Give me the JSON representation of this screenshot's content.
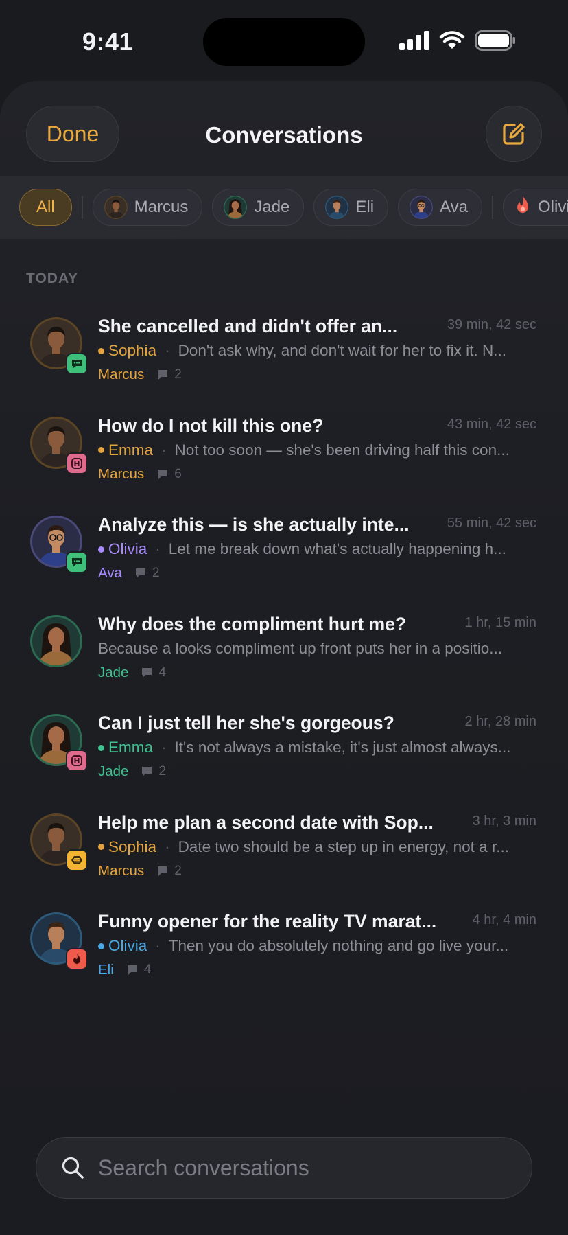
{
  "status": {
    "time": "9:41"
  },
  "nav": {
    "done_label": "Done",
    "title": "Conversations"
  },
  "filters": [
    {
      "label": "All",
      "kind": "all"
    },
    {
      "label": "Marcus",
      "kind": "person",
      "avatar": "marcus"
    },
    {
      "label": "Jade",
      "kind": "person",
      "avatar": "jade"
    },
    {
      "label": "Eli",
      "kind": "person",
      "avatar": "eli"
    },
    {
      "label": "Ava",
      "kind": "person",
      "avatar": "ava"
    },
    {
      "label": "Olivia",
      "kind": "flame"
    }
  ],
  "section_label": "TODAY",
  "conversations": [
    {
      "title": "She cancelled and didn't offer an...",
      "time": "39 min, 42 sec",
      "recipient": "Sophia",
      "preview": "Don't ask why, and don't wait for her to fix it. N...",
      "coach": "Marcus",
      "count": "2",
      "avatar": "marcus",
      "badge": "chat"
    },
    {
      "title": "How do I not kill this one?",
      "time": "43 min, 42 sec",
      "recipient": "Emma",
      "preview": "Not too soon — she's been driving half this con...",
      "coach": "Marcus",
      "count": "6",
      "avatar": "marcus",
      "badge": "hinge"
    },
    {
      "title": "Analyze this — is she actually inte...",
      "time": "55 min, 42 sec",
      "recipient": "Olivia",
      "preview": "Let me break down what's actually happening h...",
      "coach": "Ava",
      "count": "2",
      "avatar": "ava",
      "badge": "chat"
    },
    {
      "title": "Why does the compliment hurt me?",
      "time": "1 hr, 15 min",
      "recipient": "",
      "preview": "Because a looks compliment up front puts her in a positio...",
      "coach": "Jade",
      "count": "4",
      "avatar": "jade",
      "badge": ""
    },
    {
      "title": "Can I just tell her she's gorgeous?",
      "time": "2 hr, 28 min",
      "recipient": "Emma",
      "preview": "It's not always a mistake, it's just almost always...",
      "coach": "Jade",
      "count": "2",
      "avatar": "jade",
      "badge": "hinge"
    },
    {
      "title": "Help me plan a second date with Sop...",
      "time": "3 hr, 3 min",
      "recipient": "Sophia",
      "preview": "Date two should be a step up in energy, not a r...",
      "coach": "Marcus",
      "count": "2",
      "avatar": "marcus",
      "badge": "bumble"
    },
    {
      "title": "Funny opener for the reality TV marat...",
      "time": "4 hr, 4 min",
      "recipient": "Olivia",
      "preview": "Then you do absolutely nothing and go live your...",
      "coach": "Eli",
      "count": "4",
      "avatar": "eli",
      "badge": "tinder"
    }
  ],
  "coach_colors": {
    "Marcus": "#e3a33f",
    "Ava": "#a98bff",
    "Jade": "#3fc08f",
    "Eli": "#48a9e6"
  },
  "badge_colors": {
    "chat": "#3fc07a",
    "hinge": "#e06a8c",
    "bumble": "#f2b431",
    "tinder": "#ef5a4b"
  },
  "search": {
    "placeholder": "Search conversations"
  }
}
